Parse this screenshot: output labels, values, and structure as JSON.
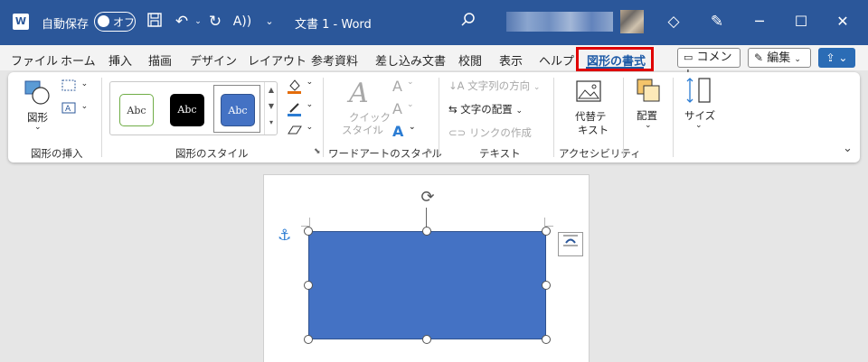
{
  "titlebar": {
    "autosave_label": "自動保存",
    "autosave_state": "オフ",
    "doc_title": "文書 1 - Word",
    "icons": [
      "word-logo-icon",
      "save-icon",
      "undo-icon",
      "redo-icon",
      "read-aloud-icon",
      "customize-icon",
      "search-icon",
      "diamond-icon",
      "pen-icon"
    ],
    "minimize": "─",
    "maximize": "☐",
    "close": "✕"
  },
  "menu": {
    "items": [
      "ファイル",
      "ホーム",
      "挿入",
      "描画",
      "デザイン",
      "レイアウト",
      "参考資料",
      "差し込み文書",
      "校閲",
      "表示",
      "ヘルプ"
    ],
    "active": "図形の書式",
    "comment_label": "コメント",
    "edit_label": "編集",
    "accent_color": "#e00000"
  },
  "ribbon": {
    "insert_shapes": {
      "shape_label": "図形",
      "group": "図形の挿入"
    },
    "shape_styles": {
      "swatches": [
        "Abc",
        "Abc",
        "Abc"
      ],
      "group": "図形のスタイル"
    },
    "wordart": {
      "quick_style_1": "クイック",
      "quick_style_2": "スタイル",
      "group": "ワードアートのスタイル"
    },
    "text": {
      "direction": "文字列の方向",
      "align": "文字の配置",
      "link": "リンクの作成",
      "group": "テキスト"
    },
    "accessibility": {
      "alt_text_1": "代替テ",
      "alt_text_2": "キスト",
      "group": "アクセシビリティ"
    },
    "arrange": {
      "label": "配置"
    },
    "size": {
      "label": "サイズ"
    }
  },
  "document": {
    "shape_color": "#4472c4",
    "anchor_icon": "anchor-icon",
    "layout_options_icon": "layout-options-icon"
  }
}
